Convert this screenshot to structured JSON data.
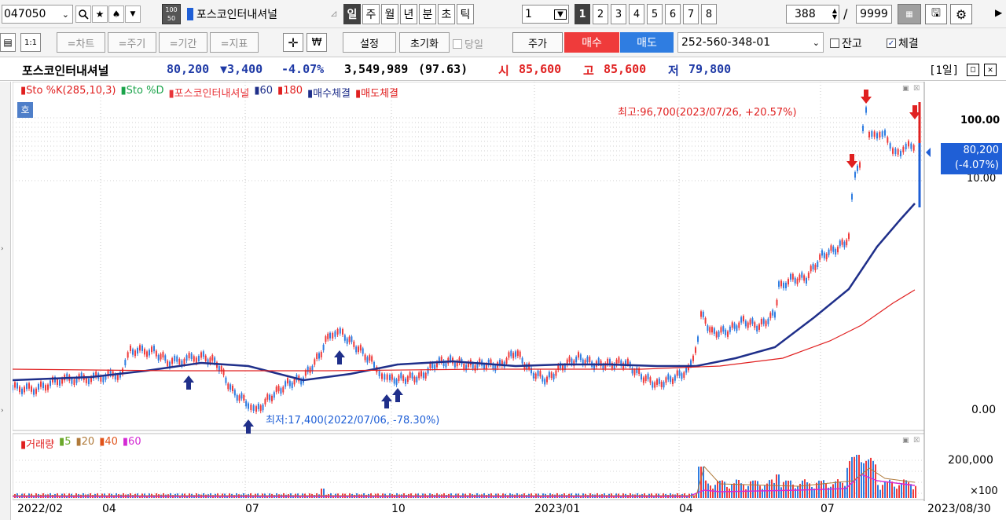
{
  "toolbar1": {
    "code": "047050",
    "name": "포스코인터내셔널",
    "hundred_top": "100",
    "hundred_bottom": "50",
    "periods": [
      "일",
      "주",
      "월",
      "년",
      "분",
      "초",
      "틱"
    ],
    "period_value": "1",
    "numbers": [
      "1",
      "2",
      "3",
      "4",
      "5",
      "6",
      "7",
      "8"
    ],
    "count": "388",
    "slash": "/",
    "max_count": "9999"
  },
  "toolbar2": {
    "mode_label": "1:1",
    "chart_btn": "=차트",
    "cycle_btn": "=주기",
    "period_btn": "=기간",
    "indicator_btn": "=지표",
    "settings": "설정",
    "reset": "초기화",
    "today_label": "당일",
    "price_btn": "주가",
    "buy_btn": "매수",
    "sell_btn": "매도",
    "account": "252-560-348-01",
    "balance_label": "잔고",
    "fill_label": "체결"
  },
  "quote": {
    "name": "포스코인터내셔널",
    "price": "80,200",
    "change": "▼3,400",
    "change_pct": "-4.07%",
    "volume": "3,549,989",
    "volume_ratio": "(97.63)",
    "open_label": "시",
    "open": "85,600",
    "high_label": "고",
    "high": "85,600",
    "low_label": "저",
    "low": "79,800",
    "period_tag": "[1일]"
  },
  "price_panel": {
    "side_tag": "호",
    "legend": [
      {
        "label": "Sto %K(285,10,3)",
        "color": "#ff3b3b"
      },
      {
        "label": "Sto %D",
        "color": "#1aa34a"
      },
      {
        "label": "포스코인터내셔널",
        "color": "#e8353a"
      },
      {
        "label": "60",
        "color": "#1f2f8a"
      },
      {
        "label": "180",
        "color": "#e02020"
      },
      {
        "label": "매수체결",
        "color": "#1f2f8a"
      },
      {
        "label": "매도체결",
        "color": "#e02020"
      }
    ],
    "high_annotation": "최고:96,700(2023/07/26, +20.57%)",
    "low_annotation": "최저:17,400(2022/07/06, -78.30%)",
    "axis_top": "100.00",
    "axis_bottom": "0.00",
    "axis_mid": "10.00",
    "price_tag": "80,200",
    "price_tag_pct": "(-4.07%)"
  },
  "volume_panel": {
    "legend": [
      {
        "label": "거래량",
        "color": "#e02020"
      },
      {
        "label": "5",
        "color": "#6aa82a"
      },
      {
        "label": "20",
        "color": "#b07a3a"
      },
      {
        "label": "40",
        "color": "#e0531a"
      },
      {
        "label": "60",
        "color": "#d42ad4"
      }
    ],
    "axis_top": "200,000",
    "axis_unit": "×100"
  },
  "x_axis": [
    "2022/02",
    "04",
    "07",
    "10",
    "2023/01",
    "04",
    "07",
    "2023/08/30"
  ]
}
